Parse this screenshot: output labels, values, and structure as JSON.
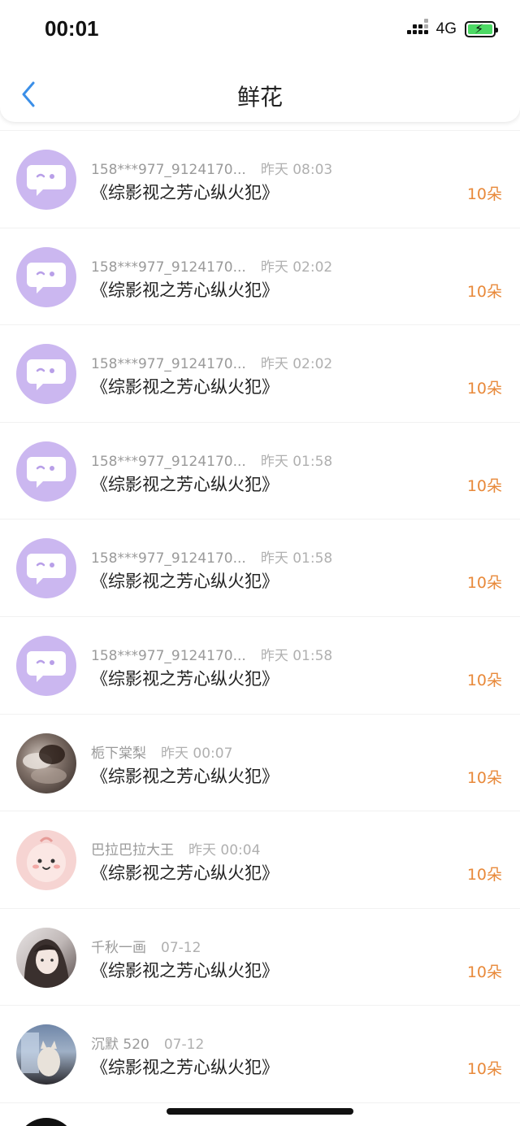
{
  "status_bar": {
    "time": "00:01",
    "network": "4G"
  },
  "header": {
    "title": "鲜花"
  },
  "items": [
    {
      "user": "158***977_9124170...",
      "time": "昨天 08:03",
      "book": "《综影视之芳心纵火犯》",
      "count": "10朵",
      "avatar": "chat-bubble-avatar"
    },
    {
      "user": "158***977_9124170...",
      "time": "昨天 02:02",
      "book": "《综影视之芳心纵火犯》",
      "count": "10朵",
      "avatar": "chat-bubble-avatar"
    },
    {
      "user": "158***977_9124170...",
      "time": "昨天 02:02",
      "book": "《综影视之芳心纵火犯》",
      "count": "10朵",
      "avatar": "chat-bubble-avatar"
    },
    {
      "user": "158***977_9124170...",
      "time": "昨天 01:58",
      "book": "《综影视之芳心纵火犯》",
      "count": "10朵",
      "avatar": "chat-bubble-avatar"
    },
    {
      "user": "158***977_9124170...",
      "time": "昨天 01:58",
      "book": "《综影视之芳心纵火犯》",
      "count": "10朵",
      "avatar": "chat-bubble-avatar"
    },
    {
      "user": "158***977_9124170...",
      "time": "昨天 01:58",
      "book": "《综影视之芳心纵火犯》",
      "count": "10朵",
      "avatar": "chat-bubble-avatar"
    },
    {
      "user": "栀下棠梨",
      "time": "昨天 00:07",
      "book": "《综影视之芳心纵火犯》",
      "count": "10朵",
      "avatar": "photo-avatar-sleeping"
    },
    {
      "user": "巴拉巴拉大王",
      "time": "昨天 00:04",
      "book": "《综影视之芳心纵火犯》",
      "count": "10朵",
      "avatar": "cartoon-avatar-pink"
    },
    {
      "user": "千秋一画",
      "time": "07-12",
      "book": "《综影视之芳心纵火犯》",
      "count": "10朵",
      "avatar": "illustrated-avatar-girl"
    },
    {
      "user": "沉默 520",
      "time": "07-12",
      "book": "《综影视之芳心纵火犯》",
      "count": "10朵",
      "avatar": "photo-avatar-cat"
    }
  ],
  "colors": {
    "accent": "#3b8fe8",
    "count": "#e8893a",
    "avatar_default": "#cbb7f0"
  }
}
